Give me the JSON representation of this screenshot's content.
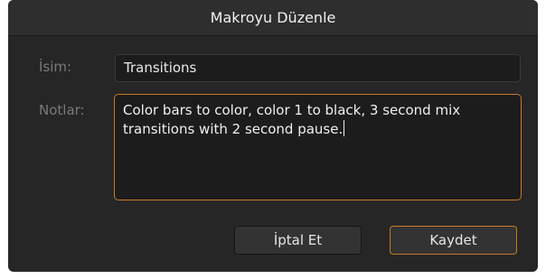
{
  "dialog": {
    "title": "Makroyu Düzenle"
  },
  "form": {
    "name_label": "İsim:",
    "name_value": "Transitions",
    "notes_label": "Notlar:",
    "notes_value": "Color bars to color, color 1 to black, 3 second mix transitions with 2 second pause."
  },
  "buttons": {
    "cancel_label": "İptal Et",
    "save_label": "Kaydet"
  },
  "colors": {
    "accent": "#c97a1e",
    "dialog_bg": "#262626",
    "field_bg": "#1c1c1c"
  }
}
